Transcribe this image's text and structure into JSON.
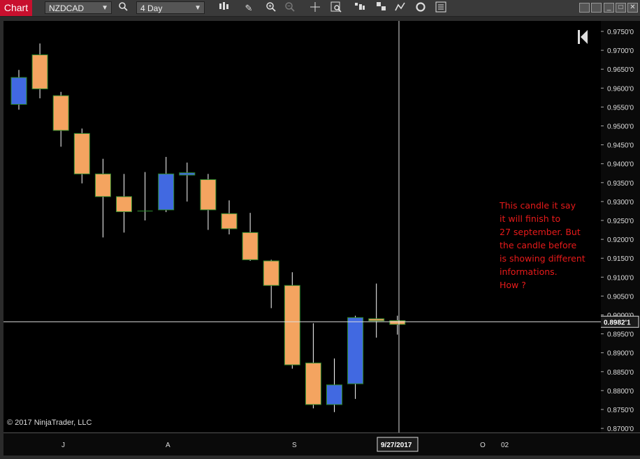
{
  "window": {
    "tab_label": "Chart"
  },
  "toolbar": {
    "instrument": "NZDCAD",
    "period": "4 Day",
    "icons": [
      "search-icon",
      "bar-style-icon",
      "pencil-icon",
      "zoom-in-icon",
      "zoom-out-icon",
      "crosshair-icon",
      "data-box-icon",
      "layout-icon",
      "panels-icon",
      "indicators-icon",
      "refresh-icon",
      "properties-icon"
    ]
  },
  "annotation": {
    "lines": [
      "This candle it say",
      "it will finish to",
      "27 september. But",
      "the candle before",
      "is showing different",
      "informations.",
      "How ?"
    ],
    "color": "#e81a1a"
  },
  "copyright": "© 2017 NinjaTrader, LLC",
  "price_marker": "0.8982'1",
  "date_marker": "9/27/2017",
  "colors": {
    "up": "#4169e1",
    "down": "#f4a460",
    "background": "#000000",
    "outline": "#2e8b2e"
  },
  "chart_data": {
    "type": "candlestick",
    "instrument": "NZDCAD",
    "timeframe": "4 Day",
    "ylim": [
      0.868,
      0.9755
    ],
    "y_ticks": [
      "0.9750'0",
      "0.9700'0",
      "0.9650'0",
      "0.9600'0",
      "0.9550'0",
      "0.9500'0",
      "0.9450'0",
      "0.9400'0",
      "0.9350'0",
      "0.9300'0",
      "0.9250'0",
      "0.9200'0",
      "0.9150'0",
      "0.9100'0",
      "0.9050'0",
      "0.9000'0",
      "0.8950'0",
      "0.8900'0",
      "0.8850'0",
      "0.8800'0",
      "0.8750'0",
      "0.8700'0"
    ],
    "x_labels": [
      "J",
      "A",
      "S",
      "O",
      "02"
    ],
    "candles": [
      {
        "open": 0.9557,
        "close": 0.9628,
        "high": 0.9648,
        "low": 0.9543
      },
      {
        "open": 0.9688,
        "close": 0.9598,
        "high": 0.9718,
        "low": 0.9573
      },
      {
        "open": 0.958,
        "close": 0.9488,
        "high": 0.959,
        "low": 0.9445
      },
      {
        "open": 0.948,
        "close": 0.9373,
        "high": 0.9493,
        "low": 0.9348
      },
      {
        "open": 0.9373,
        "close": 0.9313,
        "high": 0.9413,
        "low": 0.9205
      },
      {
        "open": 0.9313,
        "close": 0.9273,
        "high": 0.9373,
        "low": 0.9218
      },
      {
        "open": 0.9275,
        "close": 0.9274,
        "high": 0.9378,
        "low": 0.925
      },
      {
        "open": 0.9278,
        "close": 0.9373,
        "high": 0.9418,
        "low": 0.9272
      },
      {
        "open": 0.937,
        "close": 0.9376,
        "high": 0.9403,
        "low": 0.93
      },
      {
        "open": 0.9358,
        "close": 0.9278,
        "high": 0.9373,
        "low": 0.9225
      },
      {
        "open": 0.9268,
        "close": 0.9228,
        "high": 0.9303,
        "low": 0.9213
      },
      {
        "open": 0.9218,
        "close": 0.9146,
        "high": 0.927,
        "low": 0.9143
      },
      {
        "open": 0.9143,
        "close": 0.9078,
        "high": 0.9146,
        "low": 0.9018
      },
      {
        "open": 0.9078,
        "close": 0.8868,
        "high": 0.9113,
        "low": 0.8858
      },
      {
        "open": 0.8873,
        "close": 0.8763,
        "high": 0.8978,
        "low": 0.8753
      },
      {
        "open": 0.8763,
        "close": 0.8815,
        "high": 0.8885,
        "low": 0.8743
      },
      {
        "open": 0.8818,
        "close": 0.8993,
        "high": 0.8998,
        "low": 0.8778
      },
      {
        "open": 0.899,
        "close": 0.8985,
        "high": 0.9083,
        "low": 0.894
      },
      {
        "open": 0.8985,
        "close": 0.8975,
        "high": 0.8998,
        "low": 0.8948
      }
    ],
    "crosshair_price": 0.8982,
    "crosshair_date": "9/27/2017"
  }
}
